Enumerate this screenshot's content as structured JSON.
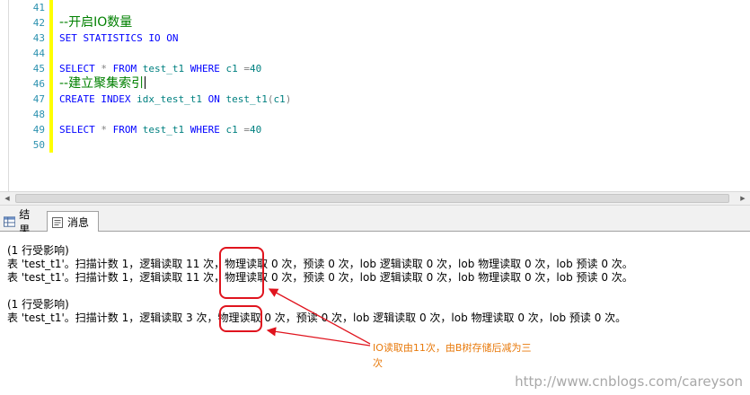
{
  "editor": {
    "line_numbers": [
      "41",
      "42",
      "43",
      "44",
      "45",
      "46",
      "47",
      "48",
      "49",
      "50"
    ],
    "lines": [
      {
        "type": "empty"
      },
      {
        "type": "comment",
        "text": "--开启IO数量"
      },
      {
        "type": "code",
        "tokens": [
          {
            "k": "kw",
            "t": "SET STATISTICS IO ON"
          }
        ]
      },
      {
        "type": "empty"
      },
      {
        "type": "code",
        "tokens": [
          {
            "k": "kw",
            "t": "SELECT "
          },
          {
            "k": "gr",
            "t": "* "
          },
          {
            "k": "kw",
            "t": "FROM "
          },
          {
            "k": "id",
            "t": "test_t1 "
          },
          {
            "k": "kw",
            "t": "WHERE "
          },
          {
            "k": "id",
            "t": "c1 "
          },
          {
            "k": "gr",
            "t": "="
          },
          {
            "k": "id",
            "t": "40"
          }
        ]
      },
      {
        "type": "comment",
        "text": "--建立聚集索引",
        "caret": true
      },
      {
        "type": "code",
        "tokens": [
          {
            "k": "kw",
            "t": "CREATE INDEX "
          },
          {
            "k": "id",
            "t": "idx_test_t1 "
          },
          {
            "k": "kw",
            "t": "ON "
          },
          {
            "k": "id",
            "t": "test_t1"
          },
          {
            "k": "gr",
            "t": "("
          },
          {
            "k": "id",
            "t": "c1"
          },
          {
            "k": "gr",
            "t": ")"
          }
        ]
      },
      {
        "type": "empty"
      },
      {
        "type": "code",
        "tokens": [
          {
            "k": "kw",
            "t": "SELECT "
          },
          {
            "k": "gr",
            "t": "* "
          },
          {
            "k": "kw",
            "t": "FROM "
          },
          {
            "k": "id",
            "t": "test_t1 "
          },
          {
            "k": "kw",
            "t": "WHERE "
          },
          {
            "k": "id",
            "t": "c1 "
          },
          {
            "k": "gr",
            "t": "="
          },
          {
            "k": "id",
            "t": "40"
          }
        ]
      },
      {
        "type": "empty"
      }
    ]
  },
  "tabs": {
    "results_label": "结果",
    "messages_label": "消息"
  },
  "messages": {
    "rows_affected_1": "(1 行受影响)",
    "line_1": "表 'test_t1'。扫描计数 1，逻辑读取 11 次，物理读取 0 次，预读 0 次，lob 逻辑读取 0 次，lob 物理读取 0 次，lob 预读 0 次。",
    "line_2": "表 'test_t1'。扫描计数 1，逻辑读取 11 次，物理读取 0 次，预读 0 次，lob 逻辑读取 0 次，lob 物理读取 0 次，lob 预读 0 次。",
    "rows_affected_2": "(1 行受影响)",
    "line_3": "表 'test_t1'。扫描计数 1，逻辑读取 3 次，物理读取 0 次，预读 0 次，lob 逻辑读取 0 次，lob 物理读取 0 次，lob 预读 0 次。"
  },
  "annotation": {
    "text": "IO读取由11次，由B树存储后减为三次"
  },
  "watermark": "http://www.cnblogs.com/careyson",
  "colors": {
    "keyword": "#0000ff",
    "comment": "#008000",
    "line_number": "#2b91af",
    "highlight_box": "#e0141e",
    "annotation_text": "#e87a0c"
  }
}
